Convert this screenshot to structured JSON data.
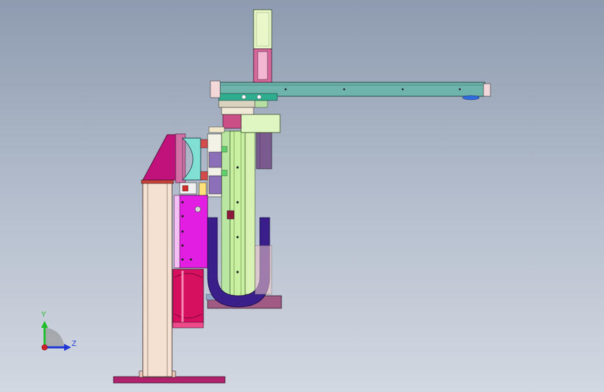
{
  "view": {
    "name": "cad-assembly-viewport",
    "background_top": "#8e9bb0",
    "background_bottom": "#d2d8e1"
  },
  "triad": {
    "y_label": "Y",
    "z_label": "Z",
    "y_color": "#1fbf2a",
    "z_color": "#1e36d6",
    "x_color": "#d0202a"
  },
  "parts": {
    "base_plate": "#b2216b",
    "column": "#f5e1d2",
    "gusset": "#c0127a",
    "bracket_magenta": "#e31ee3",
    "cylinder": "#d6105f",
    "slide_rail": "#c7f0a0",
    "cable_chain": "#3a1f8a",
    "arm_beam": "#6fb3ad",
    "motor": "#e9f7c9",
    "motor_hub": "#d7699a",
    "teal_block": "#1fb7a0",
    "purple_block": "#8b6fb8"
  }
}
